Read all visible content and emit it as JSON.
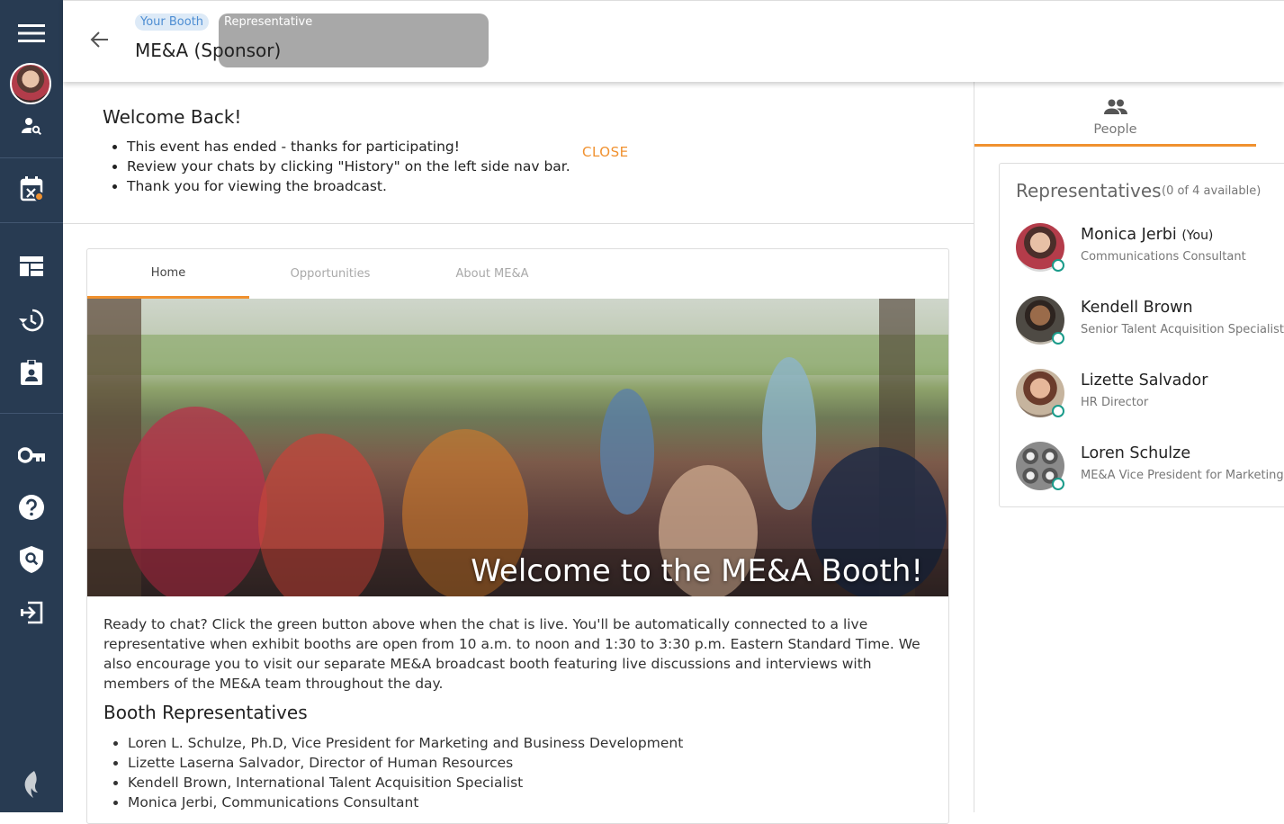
{
  "header": {
    "tags": [
      "Your Booth",
      "Representative"
    ],
    "title": "ME&A (Sponsor)"
  },
  "nav": {
    "icons": [
      "menu-icon",
      "avatar",
      "person-search-icon",
      "calendar-icon",
      "dashboard-icon",
      "history-icon",
      "badge-icon",
      "key-icon",
      "help-icon",
      "shield-search-icon",
      "logout-icon",
      "brand-icon"
    ],
    "accent": "#f0912f",
    "background": "#283b52"
  },
  "welcome": {
    "title": "Welcome Back!",
    "items": [
      "This event has ended - thanks for participating!",
      "Review your chats by clicking \"History\" on the left side nav bar.",
      "Thank you for viewing the broadcast."
    ],
    "close_label": "CLOSE"
  },
  "booth": {
    "tabs": [
      "Home",
      "Opportunities",
      "About ME&A"
    ],
    "hero_text": "Welcome to the ME&A Booth!",
    "description": "Ready to chat? Click the green button above when the chat is live. You'll be automatically connected to a live representative when exhibit booths are open from 10 a.m. to noon and 1:30 to 3:30 p.m. Eastern Standard Time. We also encourage you to visit our separate ME&A broadcast booth featuring live discussions and interviews with members of the ME&A team throughout the day.",
    "reps_title": "Booth Representatives",
    "reps_list": [
      "Loren L. Schulze, Ph.D, Vice President for Marketing and Business Development",
      "Lizette Laserna Salvador, Director of Human Resources",
      "Kendell Brown, International Talent Acquisition Specialist",
      "Monica Jerbi, Communications Consultant"
    ]
  },
  "right": {
    "people_label": "People",
    "reps_title": "Representatives",
    "reps_count": "(0 of 4 available)",
    "reps": [
      {
        "name": "Monica Jerbi",
        "suffix": "(You)",
        "role": "Communications Consultant"
      },
      {
        "name": "Kendell Brown",
        "suffix": "",
        "role": "Senior Talent Acquisition Specialist"
      },
      {
        "name": "Lizette Salvador",
        "suffix": "",
        "role": "HR Director"
      },
      {
        "name": "Loren Schulze",
        "suffix": "",
        "role": "ME&A Vice President for Marketing"
      }
    ],
    "status_color": "#1a9b8a"
  }
}
